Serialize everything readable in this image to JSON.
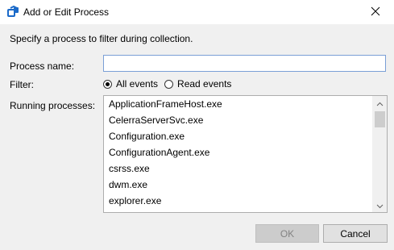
{
  "window": {
    "title": "Add or Edit Process"
  },
  "instruction": "Specify a process to filter during collection.",
  "process_name": {
    "label": "Process name:",
    "value": "",
    "placeholder": ""
  },
  "filter": {
    "label": "Filter:",
    "options": [
      {
        "label": "All events",
        "selected": true
      },
      {
        "label": "Read events",
        "selected": false
      }
    ]
  },
  "running_processes": {
    "label": "Running processes:",
    "items": [
      "ApplicationFrameHost.exe",
      "CelerraServerSvc.exe",
      "Configuration.exe",
      "ConfigurationAgent.exe",
      "csrss.exe",
      "dwm.exe",
      "explorer.exe"
    ]
  },
  "buttons": {
    "ok": {
      "label": "OK",
      "enabled": false
    },
    "cancel": {
      "label": "Cancel",
      "enabled": true
    }
  },
  "icons": {
    "app": "app-icon",
    "close": "close-icon",
    "scroll_up": "chevron-up-icon",
    "scroll_down": "chevron-down-icon"
  },
  "colors": {
    "app_icon": "#1b6ac9",
    "dialog_background": "#f0f0f0",
    "input_border_focus": "#7a9fd6",
    "ok_disabled_text": "#838383"
  }
}
